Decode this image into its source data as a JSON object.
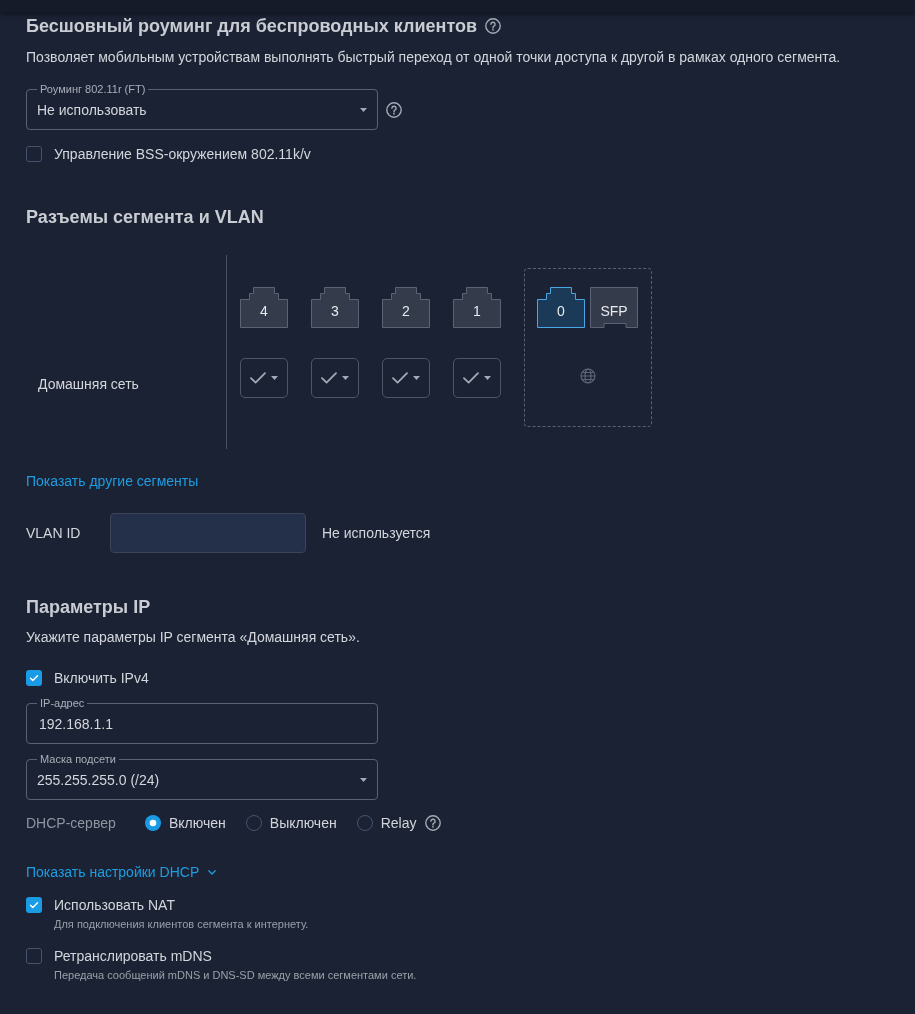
{
  "roaming": {
    "title": "Бесшовный роуминг для беспроводных клиентов",
    "description": "Позволяет мобильным устройствам выполнять быстрый переход от одной точки доступа к другой в рамках одного сегмента.",
    "mode_select": {
      "label": "Роуминг 802.11r (FT)",
      "value": "Не использовать"
    },
    "options": [
      {
        "label": "Управление BSS-окружением 802.11k/v",
        "checked": false
      }
    ]
  },
  "ports": {
    "title": "Разъемы сегмента и VLAN",
    "segment": "Домашняя сеть",
    "lan_ports": [
      {
        "label": "4",
        "member": true
      },
      {
        "label": "3",
        "member": true
      },
      {
        "label": "2",
        "member": true
      },
      {
        "label": "1",
        "member": true
      }
    ],
    "uplink_ports": [
      {
        "label": "0",
        "kind": "ethernet",
        "selected": true
      },
      {
        "label": "SFP",
        "kind": "sfp",
        "selected": false
      }
    ],
    "more_link": "Показать другие сегменты",
    "vlan": {
      "label": "VLAN ID",
      "status": "Не используется"
    }
  },
  "ip": {
    "title": "Параметры IP",
    "description": "Укажите параметры IP сегмента «Домашняя сеть».",
    "ipv4": {
      "label": "Включить IPv4",
      "checked": true
    },
    "address": {
      "label": "IP-адрес",
      "value": "192.168.1.1"
    },
    "mask": {
      "label": "Маска подсети",
      "value": "255.255.255.0 (/24)"
    },
    "dhcp_server": {
      "label": "DHCP-сервер",
      "options": [
        {
          "label": "Включен",
          "selected": true
        },
        {
          "label": "Выключен",
          "selected": false
        },
        {
          "label": "Relay",
          "selected": false
        }
      ]
    },
    "dhcp_link": {
      "label": "Показать настройки DHCP",
      "expanded": false
    },
    "options": [
      {
        "label": "Использовать NAT",
        "hint": "Для подключения клиентов сегмента к интернету.",
        "checked": true
      },
      {
        "label": "Ретранслировать mDNS",
        "hint": "Передача сообщений mDNS и DNS-SD между всеми сегментами сети.",
        "checked": false
      }
    ]
  }
}
